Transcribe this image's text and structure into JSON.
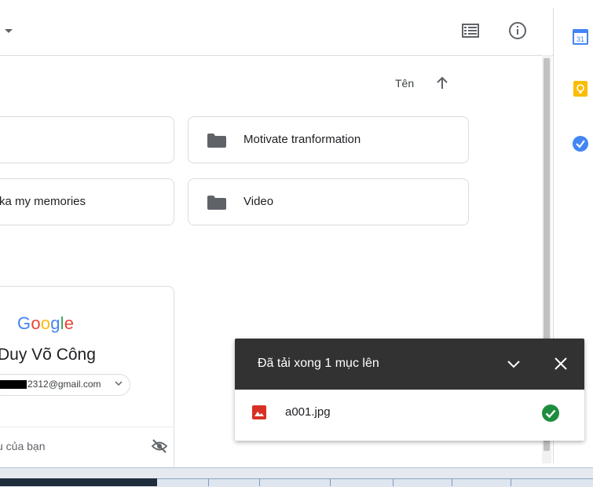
{
  "sort": {
    "label": "Tên"
  },
  "folders": [
    {
      "name": ""
    },
    {
      "name": "Motivate tranformation"
    },
    {
      "name": "ka my memories"
    },
    {
      "name": "Video"
    }
  ],
  "account_card": {
    "logo_text": "Google",
    "name": "Duy Võ Công",
    "email_visible": "2312@gmail.com",
    "footer_text": "u của bạn"
  },
  "upload_panel": {
    "title": "Đã tải xong 1 mục lên",
    "file_name": "a001.jpg",
    "status": "done"
  },
  "icons": {
    "toolbar": [
      "list-view-icon",
      "info-icon"
    ],
    "side_panel": [
      "calendar-icon",
      "keep-icon",
      "tasks-icon"
    ]
  },
  "colors": {
    "folder": "#5f6368",
    "upload_header": "#323232",
    "success": "#1e8e3e",
    "image_file": "#d93025"
  }
}
